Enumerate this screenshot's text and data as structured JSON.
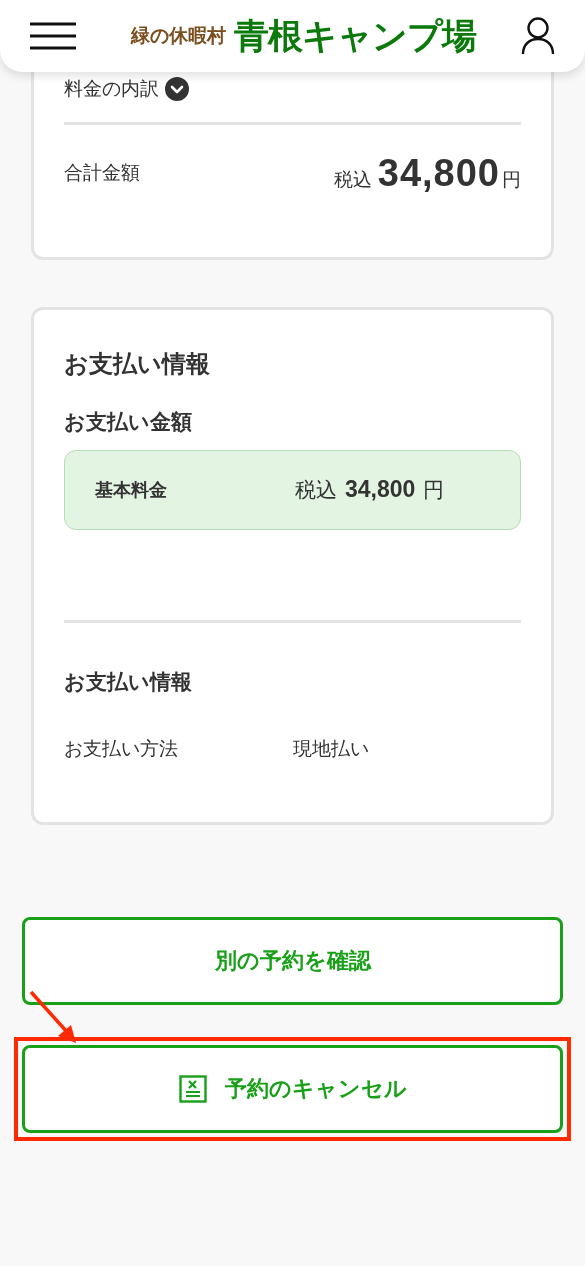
{
  "header": {
    "brand_sub": "緑の休暇村",
    "brand_main": "青根キャンプ場"
  },
  "fee_summary": {
    "breakdown_label": "料金の内訳",
    "expanded": false,
    "total_label": "合計金額",
    "tax_label": "税込",
    "total_amount": "34,800",
    "currency": "円"
  },
  "payment": {
    "title": "お支払い情報",
    "amount_heading": "お支払い金額",
    "amount_rows": [
      {
        "label": "基本料金",
        "tax_label": "税込",
        "amount": "34,800",
        "currency": "円"
      }
    ],
    "info_heading": "お支払い情報",
    "info_rows": [
      {
        "label": "お支払い方法",
        "value": "現地払い"
      }
    ]
  },
  "actions": [
    {
      "label": "別の予約を確認",
      "kind": "plain",
      "highlighted": false
    },
    {
      "label": "予約のキャンセル",
      "kind": "cancel",
      "highlighted": true
    }
  ]
}
